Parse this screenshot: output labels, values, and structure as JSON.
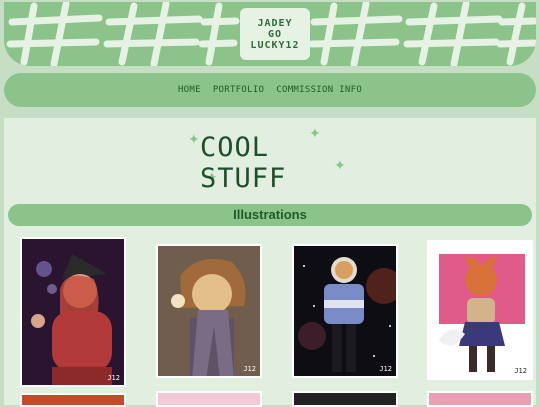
{
  "header": {
    "logo_lines": [
      "JADEY",
      "GO",
      "LUCKY12"
    ]
  },
  "nav": {
    "items": [
      {
        "label": "HOME"
      },
      {
        "label": "PORTFOLIO"
      },
      {
        "label": "COMMISSION INFO"
      }
    ]
  },
  "page": {
    "title": "COOL STUFF"
  },
  "section": {
    "title": "Illustrations"
  },
  "gallery": {
    "signature": "J12",
    "items": [
      {
        "name": "witch-girl-illustration"
      },
      {
        "name": "scarf-character-illustration"
      },
      {
        "name": "space-astronaut-illustration"
      },
      {
        "name": "fox-character-illustration"
      }
    ]
  }
}
